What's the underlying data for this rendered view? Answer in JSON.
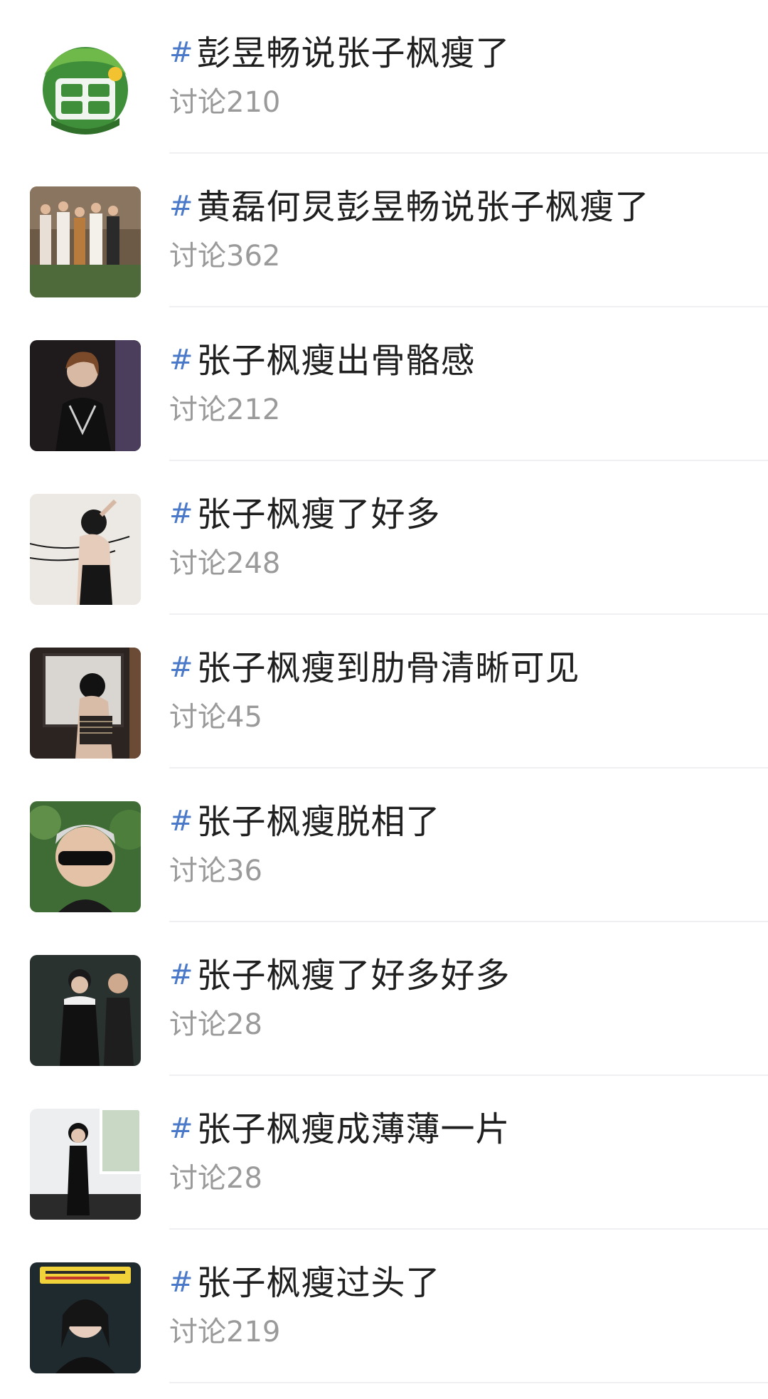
{
  "topics": [
    {
      "hash": "#",
      "title": "彭昱畅说张子枫瘦了",
      "count_label": "讨论",
      "count": "210",
      "thumb_icon": "variety-show-logo-icon"
    },
    {
      "hash": "#",
      "title": "黄磊何炅彭昱畅说张子枫瘦了",
      "count_label": "讨论",
      "count": "362",
      "thumb_icon": "group-photo-icon"
    },
    {
      "hash": "#",
      "title": "张子枫瘦出骨骼感",
      "count_label": "讨论",
      "count": "212",
      "thumb_icon": "portrait-photo-icon"
    },
    {
      "hash": "#",
      "title": "张子枫瘦了好多",
      "count_label": "讨论",
      "count": "248",
      "thumb_icon": "portrait-photo-icon"
    },
    {
      "hash": "#",
      "title": "张子枫瘦到肋骨清晰可见",
      "count_label": "讨论",
      "count": "45",
      "thumb_icon": "portrait-photo-icon"
    },
    {
      "hash": "#",
      "title": "张子枫瘦脱相了",
      "count_label": "讨论",
      "count": "36",
      "thumb_icon": "portrait-photo-icon"
    },
    {
      "hash": "#",
      "title": "张子枫瘦了好多好多",
      "count_label": "讨论",
      "count": "28",
      "thumb_icon": "portrait-photo-icon"
    },
    {
      "hash": "#",
      "title": "张子枫瘦成薄薄一片",
      "count_label": "讨论",
      "count": "28",
      "thumb_icon": "portrait-photo-icon"
    },
    {
      "hash": "#",
      "title": "张子枫瘦过头了",
      "count_label": "讨论",
      "count": "219",
      "thumb_icon": "portrait-photo-icon"
    }
  ],
  "colors": {
    "hash": "#4a79c9",
    "title": "#1f1f1f",
    "count": "#9a9a9a",
    "divider": "#f0f0f2"
  }
}
